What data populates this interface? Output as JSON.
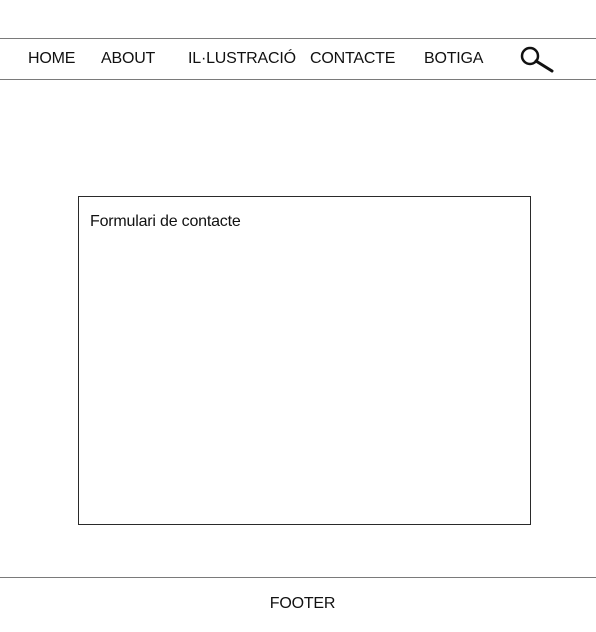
{
  "nav": {
    "home": "HOME",
    "about": "ABOUT",
    "illustration": "IL·LUSTRACIÓ",
    "contact": "CONTACTE",
    "shop": "BOTIGA",
    "search_icon": "search-icon"
  },
  "main": {
    "form_title": "Formulari de contacte"
  },
  "footer": {
    "label": "FOOTER"
  }
}
